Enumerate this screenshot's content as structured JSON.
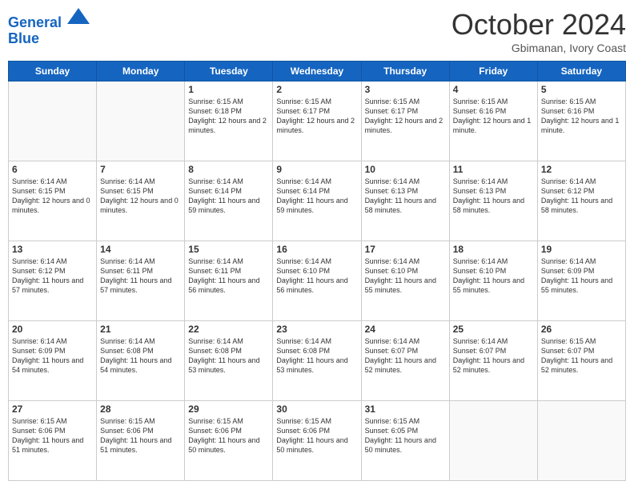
{
  "header": {
    "logo_line1": "General",
    "logo_line2": "Blue",
    "month_title": "October 2024",
    "subtitle": "Gbimanan, Ivory Coast"
  },
  "weekdays": [
    "Sunday",
    "Monday",
    "Tuesday",
    "Wednesday",
    "Thursday",
    "Friday",
    "Saturday"
  ],
  "weeks": [
    [
      {
        "day": "",
        "info": ""
      },
      {
        "day": "",
        "info": ""
      },
      {
        "day": "1",
        "info": "Sunrise: 6:15 AM\nSunset: 6:18 PM\nDaylight: 12 hours and 2 minutes."
      },
      {
        "day": "2",
        "info": "Sunrise: 6:15 AM\nSunset: 6:17 PM\nDaylight: 12 hours and 2 minutes."
      },
      {
        "day": "3",
        "info": "Sunrise: 6:15 AM\nSunset: 6:17 PM\nDaylight: 12 hours and 2 minutes."
      },
      {
        "day": "4",
        "info": "Sunrise: 6:15 AM\nSunset: 6:16 PM\nDaylight: 12 hours and 1 minute."
      },
      {
        "day": "5",
        "info": "Sunrise: 6:15 AM\nSunset: 6:16 PM\nDaylight: 12 hours and 1 minute."
      }
    ],
    [
      {
        "day": "6",
        "info": "Sunrise: 6:14 AM\nSunset: 6:15 PM\nDaylight: 12 hours and 0 minutes."
      },
      {
        "day": "7",
        "info": "Sunrise: 6:14 AM\nSunset: 6:15 PM\nDaylight: 12 hours and 0 minutes."
      },
      {
        "day": "8",
        "info": "Sunrise: 6:14 AM\nSunset: 6:14 PM\nDaylight: 11 hours and 59 minutes."
      },
      {
        "day": "9",
        "info": "Sunrise: 6:14 AM\nSunset: 6:14 PM\nDaylight: 11 hours and 59 minutes."
      },
      {
        "day": "10",
        "info": "Sunrise: 6:14 AM\nSunset: 6:13 PM\nDaylight: 11 hours and 58 minutes."
      },
      {
        "day": "11",
        "info": "Sunrise: 6:14 AM\nSunset: 6:13 PM\nDaylight: 11 hours and 58 minutes."
      },
      {
        "day": "12",
        "info": "Sunrise: 6:14 AM\nSunset: 6:12 PM\nDaylight: 11 hours and 58 minutes."
      }
    ],
    [
      {
        "day": "13",
        "info": "Sunrise: 6:14 AM\nSunset: 6:12 PM\nDaylight: 11 hours and 57 minutes."
      },
      {
        "day": "14",
        "info": "Sunrise: 6:14 AM\nSunset: 6:11 PM\nDaylight: 11 hours and 57 minutes."
      },
      {
        "day": "15",
        "info": "Sunrise: 6:14 AM\nSunset: 6:11 PM\nDaylight: 11 hours and 56 minutes."
      },
      {
        "day": "16",
        "info": "Sunrise: 6:14 AM\nSunset: 6:10 PM\nDaylight: 11 hours and 56 minutes."
      },
      {
        "day": "17",
        "info": "Sunrise: 6:14 AM\nSunset: 6:10 PM\nDaylight: 11 hours and 55 minutes."
      },
      {
        "day": "18",
        "info": "Sunrise: 6:14 AM\nSunset: 6:10 PM\nDaylight: 11 hours and 55 minutes."
      },
      {
        "day": "19",
        "info": "Sunrise: 6:14 AM\nSunset: 6:09 PM\nDaylight: 11 hours and 55 minutes."
      }
    ],
    [
      {
        "day": "20",
        "info": "Sunrise: 6:14 AM\nSunset: 6:09 PM\nDaylight: 11 hours and 54 minutes."
      },
      {
        "day": "21",
        "info": "Sunrise: 6:14 AM\nSunset: 6:08 PM\nDaylight: 11 hours and 54 minutes."
      },
      {
        "day": "22",
        "info": "Sunrise: 6:14 AM\nSunset: 6:08 PM\nDaylight: 11 hours and 53 minutes."
      },
      {
        "day": "23",
        "info": "Sunrise: 6:14 AM\nSunset: 6:08 PM\nDaylight: 11 hours and 53 minutes."
      },
      {
        "day": "24",
        "info": "Sunrise: 6:14 AM\nSunset: 6:07 PM\nDaylight: 11 hours and 52 minutes."
      },
      {
        "day": "25",
        "info": "Sunrise: 6:14 AM\nSunset: 6:07 PM\nDaylight: 11 hours and 52 minutes."
      },
      {
        "day": "26",
        "info": "Sunrise: 6:15 AM\nSunset: 6:07 PM\nDaylight: 11 hours and 52 minutes."
      }
    ],
    [
      {
        "day": "27",
        "info": "Sunrise: 6:15 AM\nSunset: 6:06 PM\nDaylight: 11 hours and 51 minutes."
      },
      {
        "day": "28",
        "info": "Sunrise: 6:15 AM\nSunset: 6:06 PM\nDaylight: 11 hours and 51 minutes."
      },
      {
        "day": "29",
        "info": "Sunrise: 6:15 AM\nSunset: 6:06 PM\nDaylight: 11 hours and 50 minutes."
      },
      {
        "day": "30",
        "info": "Sunrise: 6:15 AM\nSunset: 6:06 PM\nDaylight: 11 hours and 50 minutes."
      },
      {
        "day": "31",
        "info": "Sunrise: 6:15 AM\nSunset: 6:05 PM\nDaylight: 11 hours and 50 minutes."
      },
      {
        "day": "",
        "info": ""
      },
      {
        "day": "",
        "info": ""
      }
    ]
  ]
}
